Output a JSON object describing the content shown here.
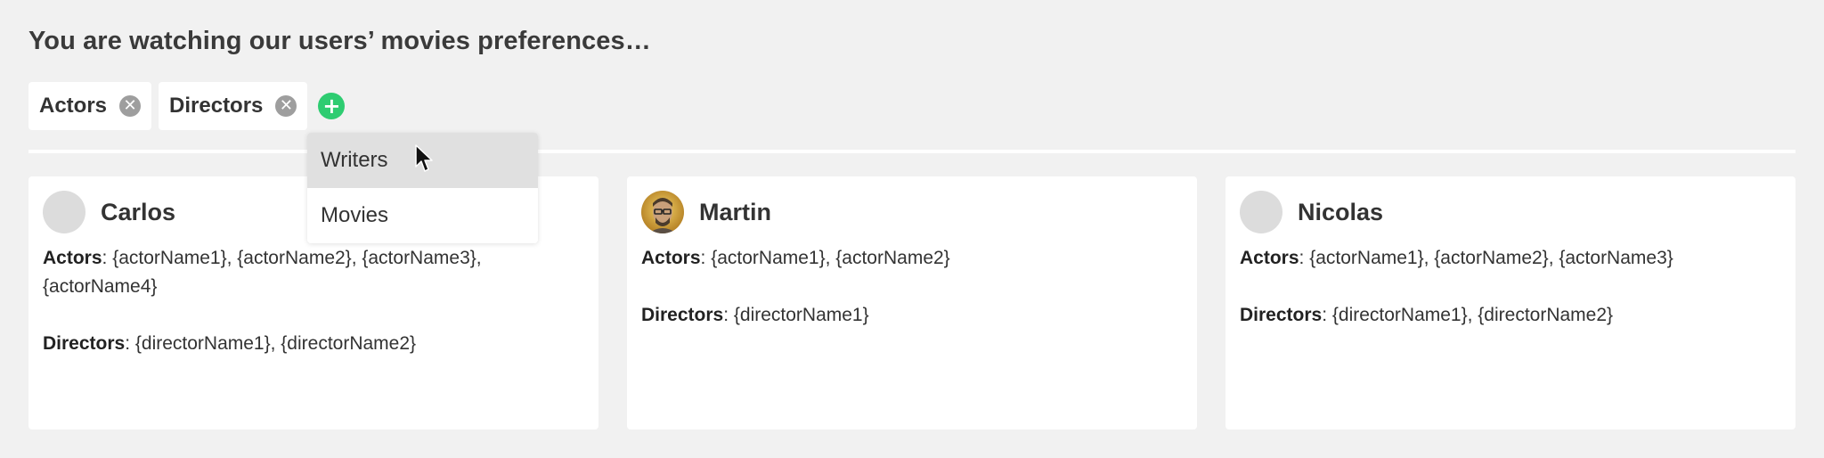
{
  "header": {
    "title": "You are watching our users’ movies preferences…"
  },
  "filters": {
    "chips": [
      {
        "label": "Actors",
        "remove_icon": "close-icon"
      },
      {
        "label": "Directors",
        "remove_icon": "close-icon"
      }
    ],
    "add_button": {
      "icon": "plus-icon",
      "color": "#2ecc71"
    }
  },
  "dropdown": {
    "items": [
      "Writers",
      "Movies"
    ],
    "highlighted": "Writers"
  },
  "cards": [
    {
      "name": "Carlos",
      "avatar": "placeholder",
      "actors_label": "Actors",
      "actors": ": {actorName1}, {actorName2}, {actorName3}, {actorName4}",
      "directors_label": "Directors",
      "directors": ": {directorName1}, {directorName2}"
    },
    {
      "name": "Martin",
      "avatar": "photo",
      "actors_label": "Actors",
      "actors": ": {actorName1}, {actorName2}",
      "directors_label": "Directors",
      "directors": ": {directorName1}"
    },
    {
      "name": "Nicolas",
      "avatar": "placeholder",
      "actors_label": "Actors",
      "actors": ": {actorName1}, {actorName2}, {actorName3}",
      "directors_label": "Directors",
      "directors": ": {directorName1}, {directorName2}"
    }
  ]
}
